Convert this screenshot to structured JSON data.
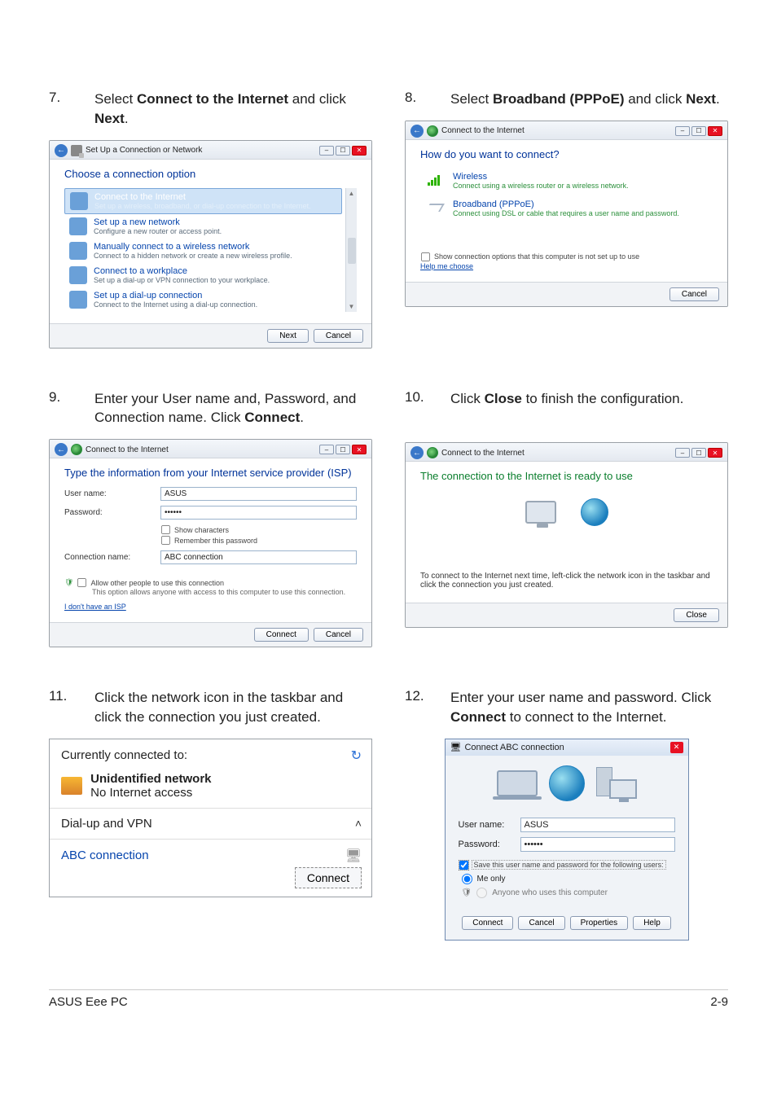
{
  "steps": {
    "7": {
      "num": "7.",
      "html": "Select <b>Connect to the Internet</b> and click <b>Next</b>."
    },
    "8": {
      "num": "8.",
      "html": "Select <b>Broadband (PPPoE)</b> and click <b>Next</b>."
    },
    "9": {
      "num": "9.",
      "html": "Enter your User name and, Password, and Connection name. Click <b>Connect</b>."
    },
    "10": {
      "num": "10.",
      "html": "Click <b>Close</b> to finish the configuration."
    },
    "11": {
      "num": "11.",
      "html": "Click the network icon in the taskbar and click the connection you just created."
    },
    "12": {
      "num": "12.",
      "html": "Enter your user name and password. Click <b>Connect</b> to connect to the Internet."
    }
  },
  "shot7": {
    "title": "Set Up a Connection or Network",
    "heading": "Choose a connection option",
    "options": [
      {
        "title": "Connect to the Internet",
        "sub": "Set up a wireless, broadband, or dial-up connection to the Internet.",
        "selected": true
      },
      {
        "title": "Set up a new network",
        "sub": "Configure a new router or access point."
      },
      {
        "title": "Manually connect to a wireless network",
        "sub": "Connect to a hidden network or create a new wireless profile."
      },
      {
        "title": "Connect to a workplace",
        "sub": "Set up a dial-up or VPN connection to your workplace."
      },
      {
        "title": "Set up a dial-up connection",
        "sub": "Connect to the Internet using a dial-up connection."
      }
    ],
    "buttons": {
      "next": "Next",
      "cancel": "Cancel"
    }
  },
  "shot8": {
    "title": "Connect to the Internet",
    "heading": "How do you want to connect?",
    "options": [
      {
        "title": "Wireless",
        "sub": "Connect using a wireless router or a wireless network.",
        "icon": "bars-icon"
      },
      {
        "title": "Broadband (PPPoE)",
        "sub": "Connect using DSL or cable that requires a user name and password.",
        "icon": "arrow-icon"
      }
    ],
    "show_more": "Show connection options that this computer is not set up to use",
    "help": "Help me choose",
    "buttons": {
      "cancel": "Cancel"
    }
  },
  "shot9": {
    "title": "Connect to the Internet",
    "heading": "Type the information from your Internet service provider (ISP)",
    "labels": {
      "user": "User name:",
      "pass": "Password:",
      "conn": "Connection name:"
    },
    "values": {
      "user": "ASUS",
      "pass": "••••••",
      "conn": "ABC connection"
    },
    "checks": {
      "show": "Show characters",
      "remember": "Remember this password",
      "allow": "Allow other people to use this connection"
    },
    "allow_sub": "This option allows anyone with access to this computer to use this connection.",
    "isp_link": "I don't have an ISP",
    "buttons": {
      "connect": "Connect",
      "cancel": "Cancel"
    }
  },
  "shot10": {
    "title": "Connect to the Internet",
    "heading": "The connection to the Internet is ready to use",
    "hint": "To connect to the Internet next time, left-click the network icon in the taskbar and click the connection you just created.",
    "buttons": {
      "close": "Close"
    }
  },
  "shot11": {
    "currently": "Currently connected to:",
    "unidentified": "Unidentified network",
    "noaccess": "No Internet access",
    "dialup": "Dial-up and VPN",
    "abc": "ABC connection",
    "connect": "Connect"
  },
  "shot12": {
    "title": "Connect ABC connection",
    "labels": {
      "user": "User name:",
      "pass": "Password:"
    },
    "values": {
      "user": "ASUS",
      "pass": "••••••"
    },
    "save": "Save this user name and password for the following users:",
    "me_only": "Me only",
    "anyone": "Anyone who uses this computer",
    "buttons": {
      "connect": "Connect",
      "cancel": "Cancel",
      "properties": "Properties",
      "help": "Help"
    }
  },
  "footer": {
    "left": "ASUS Eee PC",
    "right": "2-9"
  }
}
